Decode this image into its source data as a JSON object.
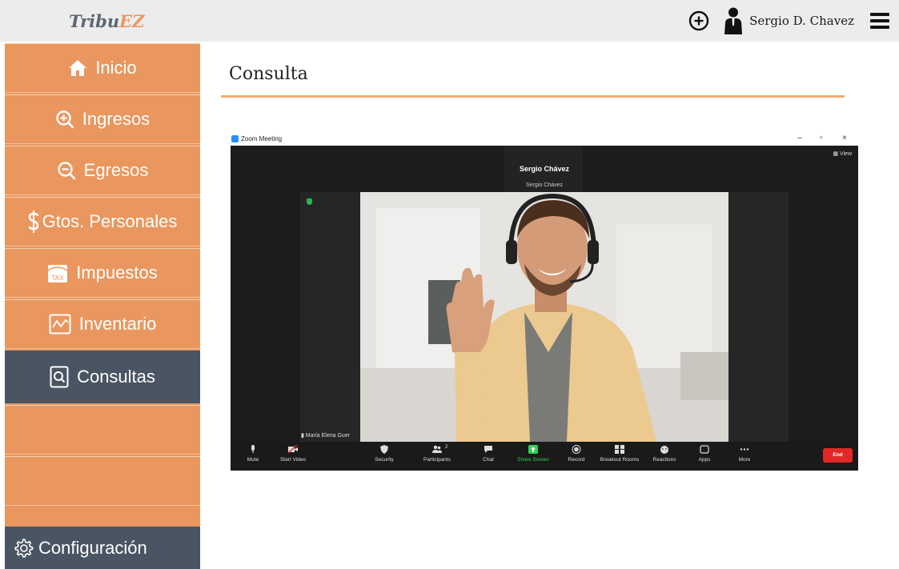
{
  "app": {
    "brand_part1": "Tribu",
    "brand_part2": "EZ",
    "user_name": "Sergio D. Chavez"
  },
  "sidebar": {
    "items": [
      {
        "label": "Inicio",
        "icon": "home-icon"
      },
      {
        "label": "Ingresos",
        "icon": "zoom-in-icon"
      },
      {
        "label": "Egresos",
        "icon": "zoom-out-icon"
      },
      {
        "label": "Gtos. Personales",
        "icon": "dollar-icon"
      },
      {
        "label": "Impuestos",
        "icon": "tax-icon"
      },
      {
        "label": "Inventario",
        "icon": "chart-icon"
      },
      {
        "label": "Consultas",
        "icon": "consult-icon",
        "active": true
      }
    ],
    "config_label": "Configuración"
  },
  "main": {
    "title": "Consulta"
  },
  "zoom": {
    "window_title": "Zoom Meeting",
    "speaker_name": "Sergio Chávez",
    "speaker_sub": "Sergio Chávez",
    "view_label": "View",
    "participant_label": "María Elena Guer",
    "toolbar": {
      "mute": "Mute",
      "start_video": "Start Video",
      "security": "Security",
      "participants": "Participants",
      "participants_count": "2",
      "chat": "Chat",
      "share_screen": "Share Screen",
      "record": "Record",
      "breakout_rooms": "Breakout Rooms",
      "reactions": "Reactions",
      "apps": "Apps",
      "more": "More",
      "end": "End"
    }
  },
  "colors": {
    "sidebar_orange": "#e9975f",
    "sidebar_dark": "#4a5563",
    "accent_rule": "#f0b070",
    "end_red": "#e02828",
    "share_green": "#2fd157"
  }
}
